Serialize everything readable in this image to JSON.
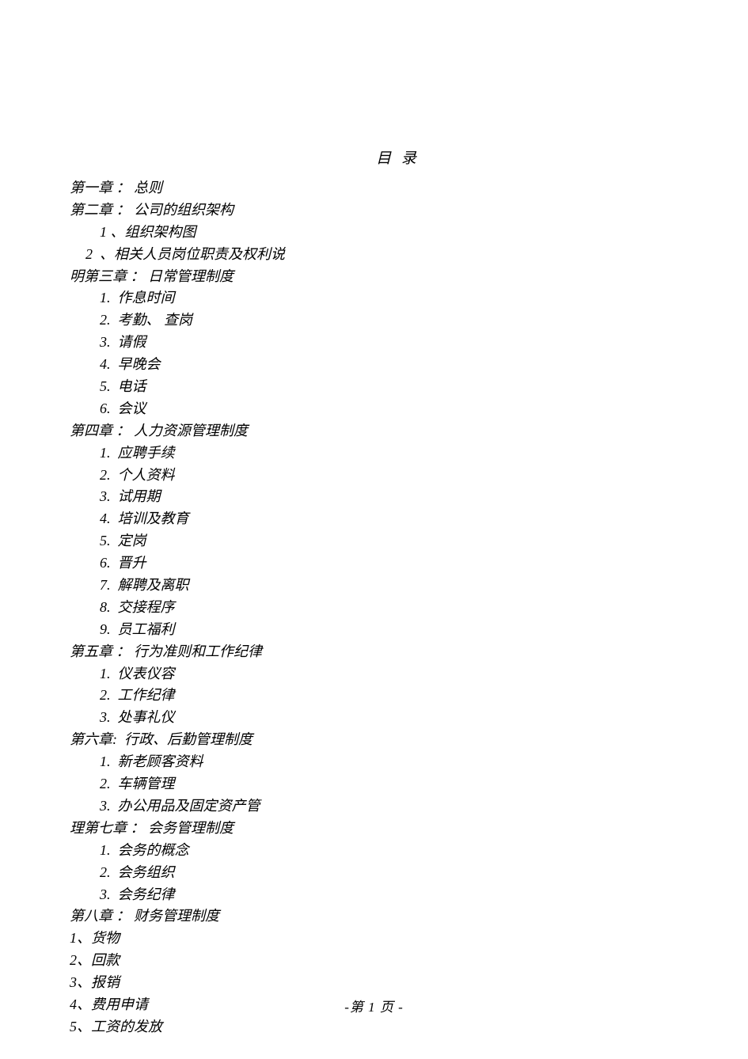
{
  "title": "目 录",
  "lines": [
    {
      "cls": "",
      "text": "第一章 ： 总则"
    },
    {
      "cls": "",
      "text": "第二章 ： 公司的组织架构"
    },
    {
      "cls": "indent1",
      "text": "1 、组织架构图"
    },
    {
      "cls": "indent0-5",
      "text": "2  、相关人员岗位职责及权利说"
    },
    {
      "cls": "",
      "text": "明第三章 ： 日常管理制度"
    },
    {
      "cls": "indent1",
      "text": "1.  作息时间"
    },
    {
      "cls": "indent1",
      "text": "2.  考勤、 查岗"
    },
    {
      "cls": "indent1",
      "text": "3.  请假"
    },
    {
      "cls": "indent1",
      "text": "4.  早晚会"
    },
    {
      "cls": "indent1",
      "text": "5.  电话"
    },
    {
      "cls": "indent1",
      "text": "6.  会议"
    },
    {
      "cls": "",
      "text": "第四章 ： 人力资源管理制度"
    },
    {
      "cls": "indent1",
      "text": "1.  应聘手续"
    },
    {
      "cls": "indent1",
      "text": "2.  个人资料"
    },
    {
      "cls": "indent1",
      "text": "3.  试用期"
    },
    {
      "cls": "indent1",
      "text": "4.  培训及教育"
    },
    {
      "cls": "indent1",
      "text": "5.  定岗"
    },
    {
      "cls": "indent1",
      "text": "6.  晋升"
    },
    {
      "cls": "indent1",
      "text": "7.  解聘及离职"
    },
    {
      "cls": "indent1",
      "text": "8.  交接程序"
    },
    {
      "cls": "indent1",
      "text": "9.  员工福利"
    },
    {
      "cls": "",
      "text": "第五章 ： 行为准则和工作纪律"
    },
    {
      "cls": "indent1",
      "text": "1.  仪表仪容"
    },
    {
      "cls": "indent1",
      "text": "2.  工作纪律"
    },
    {
      "cls": "indent1",
      "text": "3.  处事礼仪"
    },
    {
      "cls": "",
      "text": "第六章:  行政、后勤管理制度"
    },
    {
      "cls": "indent1",
      "text": "1.  新老顾客资料"
    },
    {
      "cls": "indent1",
      "text": "2.  车辆管理"
    },
    {
      "cls": "indent1",
      "text": "3.  办公用品及固定资产管"
    },
    {
      "cls": "",
      "text": "理第七章 ： 会务管理制度"
    },
    {
      "cls": "indent1",
      "text": "1.  会务的概念"
    },
    {
      "cls": "indent1",
      "text": "2.  会务组织"
    },
    {
      "cls": "indent1",
      "text": "3.  会务纪律"
    },
    {
      "cls": "",
      "text": "第八章 ： 财务管理制度"
    },
    {
      "cls": "",
      "text": "1、货物"
    },
    {
      "cls": "",
      "text": "2、回款"
    },
    {
      "cls": "",
      "text": "3、报销"
    },
    {
      "cls": "",
      "text": "4、费用申请"
    },
    {
      "cls": "",
      "text": "5、工资的发放"
    }
  ],
  "footer": "-第 1 页   -"
}
